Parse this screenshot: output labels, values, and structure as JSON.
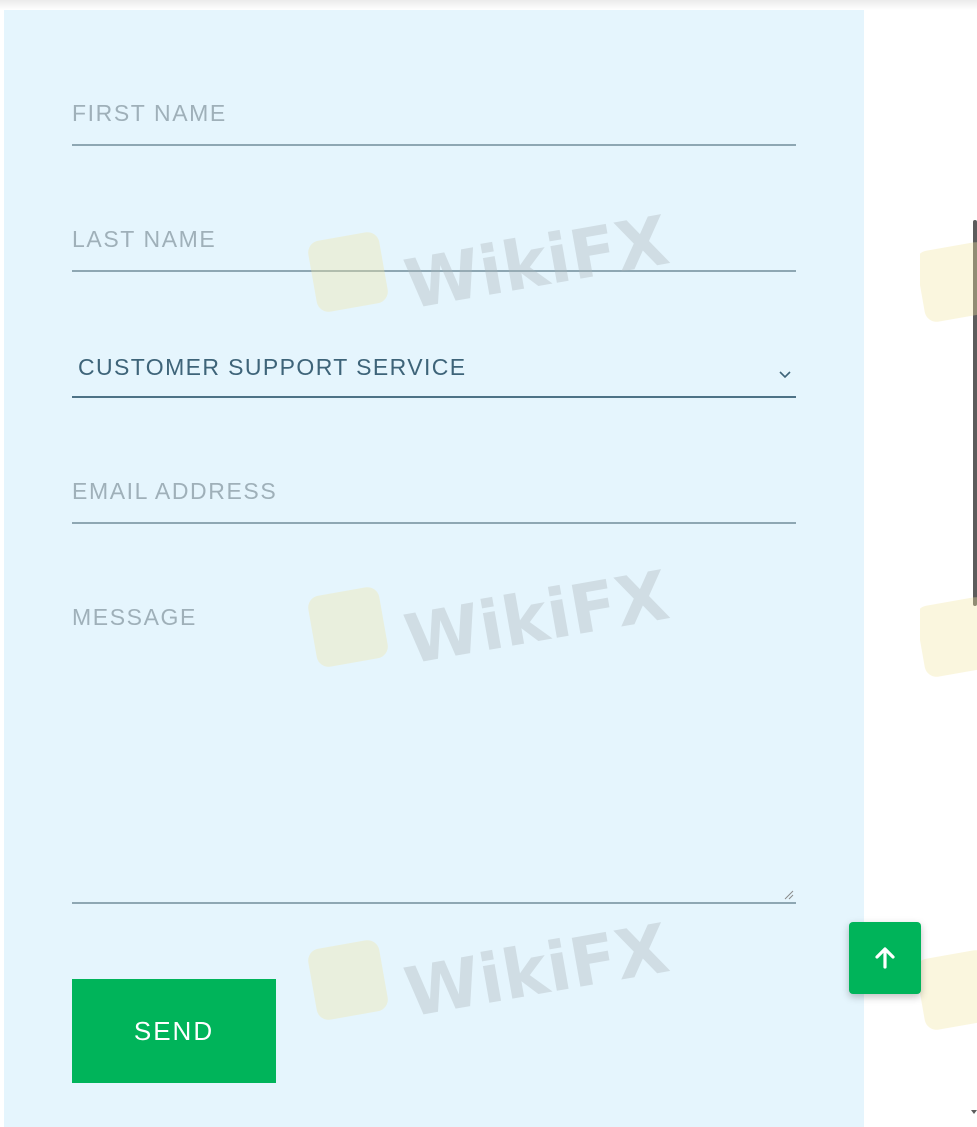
{
  "form": {
    "first_name_placeholder": "FIRST NAME",
    "last_name_placeholder": "LAST NAME",
    "department_value": "CUSTOMER SUPPORT SERVICE",
    "email_placeholder": "EMAIL ADDRESS",
    "message_placeholder": "MESSAGE",
    "send_label": "SEND"
  },
  "watermark": {
    "text": "WikiFX"
  },
  "icons": {
    "dropdown": "chevron-down-icon",
    "scroll_top": "arrow-up-icon",
    "resize": "resize-handle-icon"
  },
  "colors": {
    "panel_bg": "#e5f5fd",
    "accent": "#00b45a",
    "label": "#9fb0b9",
    "select_text": "#3e6479"
  }
}
